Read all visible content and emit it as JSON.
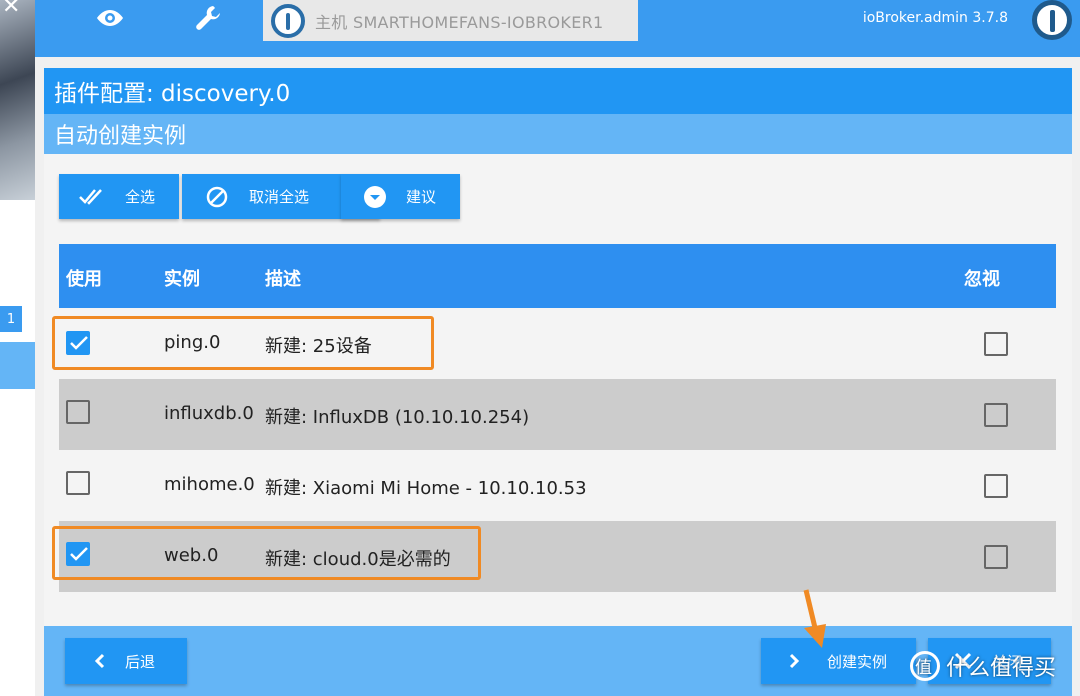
{
  "topbar": {
    "host_label": "主机 SMARTHOMEFANS-IOBROKER1",
    "version": "ioBroker.admin 3.7.8"
  },
  "left": {
    "badge": "1"
  },
  "dialog": {
    "title": "插件配置: discovery.0",
    "subtitle": "自动创建实例",
    "toolbar": {
      "select_all": "全选",
      "deselect_all": "取消全选",
      "suggest": "建议"
    },
    "table": {
      "headers": {
        "use": "使用",
        "instance": "实例",
        "description": "描述",
        "ignore": "忽视"
      },
      "rows": [
        {
          "checked": true,
          "instance": "ping.0",
          "description": "新建: 25设备",
          "ignored": false
        },
        {
          "checked": false,
          "instance": "influxdb.0",
          "description": "新建: InfluxDB (10.10.10.254)",
          "ignored": false
        },
        {
          "checked": false,
          "instance": "mihome.0",
          "description": "新建: Xiaomi Mi Home - 10.10.10.53",
          "ignored": false
        },
        {
          "checked": true,
          "instance": "web.0",
          "description": "新建: cloud.0是必需的",
          "ignored": false
        }
      ]
    },
    "footer": {
      "back": "后退",
      "create": "创建实例",
      "close_partial": "关闭"
    }
  },
  "watermark": "什么值得买",
  "colors": {
    "primary": "#2196f3",
    "light": "#64b5f6",
    "highlight": "#f08a24",
    "row_alt": "#cccccc"
  }
}
